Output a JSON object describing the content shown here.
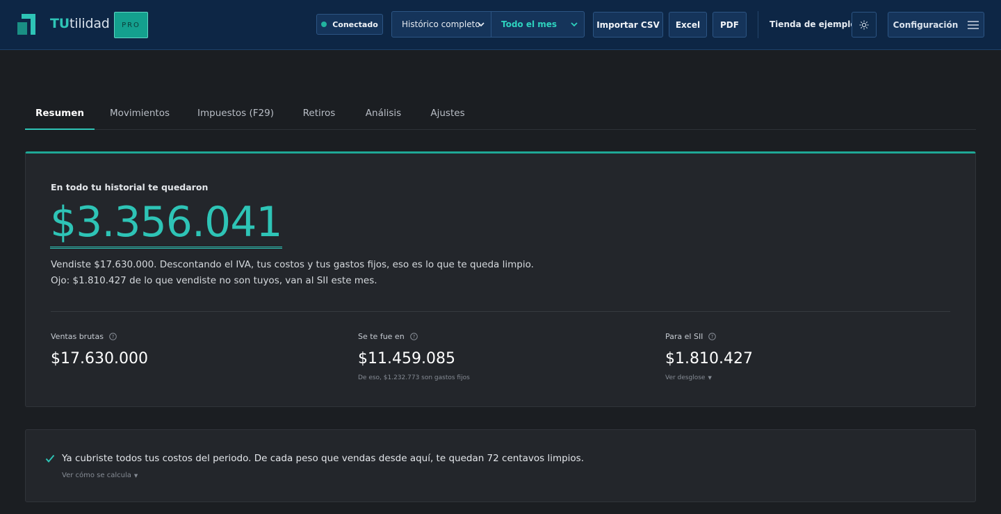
{
  "header": {
    "brand_prefix": "TU",
    "brand_suffix": "tilidad",
    "badge": "PRO",
    "status": "Conectado",
    "period_select": "Histórico completo",
    "range_select": "Todo el mes",
    "import_label": "Importar CSV",
    "excel_label": "Excel",
    "pdf_label": "PDF",
    "store_name": "Tienda de ejemplo",
    "config_label": "Configuración",
    "colors": {
      "accent": "#2ec4b6",
      "header_bg": "#0d2645"
    },
    "icons": {
      "logo": "tutilidad-logo-icon",
      "theme": "sun-icon",
      "menu": "hamburger-menu-icon",
      "chevron": "chevron-down-icon"
    }
  },
  "tabs": [
    {
      "label": "Resumen",
      "active": true
    },
    {
      "label": "Movimientos",
      "active": false
    },
    {
      "label": "Impuestos (F29)",
      "active": false
    },
    {
      "label": "Retiros",
      "active": false
    },
    {
      "label": "Análisis",
      "active": false
    },
    {
      "label": "Ajustes",
      "active": false
    }
  ],
  "summary": {
    "label": "En todo tu historial te quedaron",
    "amount": "$3.356.041",
    "description_1": "Vendiste $17.630.000. Descontando el IVA, tus costos y tus gastos fijos, eso es lo que te queda limpio.",
    "description_2": "Ojo: $1.810.427 de lo que vendiste no son tuyos, van al SII este mes.",
    "stats": [
      {
        "label": "Ventas brutas",
        "value": "$17.630.000",
        "sub": ""
      },
      {
        "label": "Se te fue en",
        "value": "$11.459.085",
        "sub": "De eso, $1.232.773 son gastos fijos"
      },
      {
        "label": "Para el SII",
        "value": "$1.810.427",
        "sub": "Ver desglose"
      }
    ]
  },
  "notice": {
    "text": "Ya cubriste todos tus costos del periodo. De cada peso que vendas desde aquí, te quedan 72 centavos limpios.",
    "link": "Ver cómo se calcula"
  }
}
